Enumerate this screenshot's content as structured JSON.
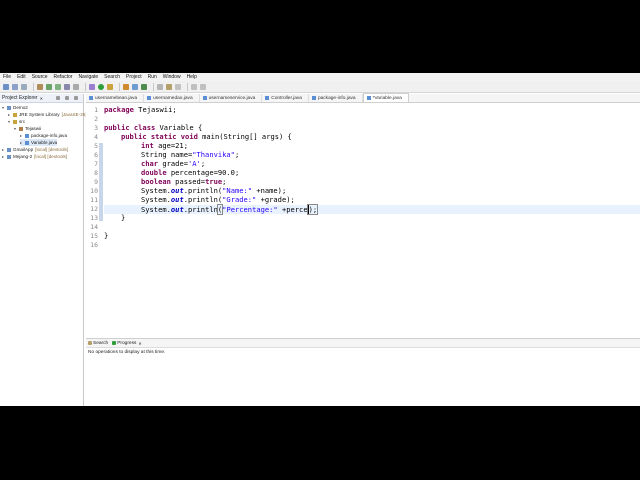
{
  "menu": [
    "File",
    "Edit",
    "Source",
    "Refactor",
    "Navigate",
    "Search",
    "Project",
    "Run",
    "Window",
    "Help"
  ],
  "explorer": {
    "title": "Project Explorer",
    "close": "✕",
    "nodes": [
      {
        "label": "Demo2",
        "extra": ""
      },
      {
        "label": "JRE System Library",
        "extra": "[JavaSE-25]"
      },
      {
        "label": "src",
        "extra": ""
      },
      {
        "label": "Tejaswii",
        "extra": ""
      },
      {
        "label": "package-info.java",
        "extra": ""
      },
      {
        "label": "Variable.java",
        "extra": ""
      },
      {
        "label": "GmailApp",
        "extra": "[local] [devtools]"
      },
      {
        "label": "Mejang-2",
        "extra": "[local] [devtools]"
      }
    ]
  },
  "tabs": [
    {
      "label": "usernamebean.java"
    },
    {
      "label": "usernamedao.java"
    },
    {
      "label": "usernameservice.java"
    },
    {
      "label": "Controller.java"
    },
    {
      "label": "package-info.java"
    },
    {
      "label": "*Variable.java"
    }
  ],
  "editor": {
    "line_numbers": [
      "1",
      "2",
      "3",
      "4",
      "5",
      "6",
      "7",
      "8",
      "9",
      "10",
      "11",
      "12",
      "13",
      "14",
      "15",
      "16"
    ],
    "code": {
      "l1_kw": "package",
      "l1_rest": " Tejaswii;",
      "l3_kw": "public class",
      "l3_rest": " Variable {",
      "l4_kw": "public static void",
      "l4_rest": " main(String[] args) {",
      "l5_kw": "int",
      "l5_rest": " age=21;",
      "l6_a": "String name=",
      "l6_str": "\"Thanvika\"",
      "l6_b": ";",
      "l7_kw": "char",
      "l7_a": " grade=",
      "l7_str": "'A'",
      "l7_b": ";",
      "l8_kw": "double",
      "l8_rest": " percentage=90.0;",
      "l9_kw": "boolean",
      "l9_a": " passed=",
      "l9_kw2": "true",
      "l9_b": ";",
      "l10_a": "System.",
      "l10_fld": "out",
      "l10_b": ".println(",
      "l10_str": "\"Name:\"",
      "l10_c": " +name);",
      "l11_a": "System.",
      "l11_fld": "out",
      "l11_b": ".println(",
      "l11_str": "\"Grade:\"",
      "l11_c": " +grade);",
      "l12_a": "System.",
      "l12_fld": "out",
      "l12_b": ".println",
      "l12_p": "(",
      "l12_str": "\"Percentage:\"",
      "l12_c": " +perce",
      "l12_d": ");",
      "l13": "}",
      "l15": "}"
    }
  },
  "bottom": {
    "tab_search": "Search",
    "tab_progress": "Progress",
    "close": "✕",
    "message": "No operations to display at this time."
  },
  "colors": {
    "keyword": "#7f0055",
    "string": "#2a00ff",
    "field": "#0000c0",
    "current_line": "#e8f2fe"
  }
}
